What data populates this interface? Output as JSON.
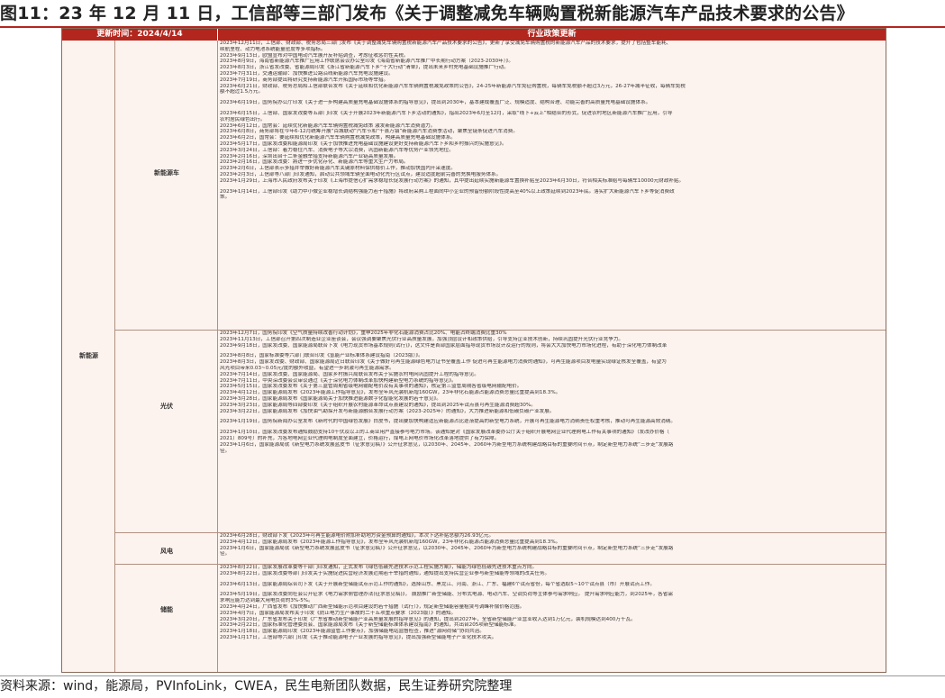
{
  "title": "图11：23 年 12 月 11 日，工信部等三部门发布《关于调整减免车辆购置税新能源汽车产品技术要求的公告》",
  "table": {
    "header_left": "更新时间：2024/4/14",
    "header_right": "行业政策更新",
    "category_main": "新能源",
    "sub_ev": "新能源车",
    "sub_pv": "光伏",
    "sub_wind": "风电",
    "sub_storage": "储能"
  },
  "ev_items": [
    "2023年12月11日，工信部、财政部、税务总局三部门发布《关于调整减免车辆购置税新能源汽车产品技术要求的公告》，更新了享受减免车辆购置税的新能源汽车产品的技术要求，提升了包括整车能耗、",
    "续航里程、动力电池系统能量密度等多项指标。",
    "2023年9月13日，欧盟宣布对中国电动汽车展开反补贴调查，考虑征收惩罚性关税。",
    "2023年8月9日，海南省新能源汽车推广应用工作联席会议办公室印发《海南省新能源汽车推广中长期行动方案（2023-2030年）》。",
    "2023年8月3日，浙江省发改委、省能源局印发《浙江省新能源汽车下乡“十大行动”清单》，提出未来乡村充电基础设施推广行动。",
    "2023年7月31日，交通运输部：加快推进公路沿线新能源汽车充电设施建设。",
    "2023年7月19日，商务部提出将研究支持新能源汽车开拓国际市场等举措。",
    "2023年6月21日，财政部、税务总局和工信部联合发布《关于延续和优化新能源汽车车辆购置税减免政策的公告》，24-25年新能源汽车免征购置税，每辆车免税额不超过3万元，26-27年减半征收，每辆车免税",
    "额不超过1.5万元。",
    "",
    "2023年6月19日，国务院办公厅印发《关于进一步构建高质量充电基础设施体系的指导意见》，提出到2030年，基本建成覆盖广泛、规模适度、结构合理、功能完善的高质量充电基础设施体系。",
    "",
    "2023年6月15日，工信部、国家发改委等五部门印发《关于开展2023年新能源汽车下乡活动的通知》，指出2023年6月至12月，采取“线下+云上”相结合的形式，促进农村地区新能源汽车推广应用，引导",
    "农村居民绿色出行。",
    "2023年6月12日，国常会：延续优化新能源汽车车辆购置税减免政策 激发新能源汽车消费潜力。",
    "2023年6月8日，商务部将在今年6-12月统筹开展“百城联动”汽车节和“千县万镇”新能源汽车消费季活动，聚焦全链条促进汽车消费。",
    "2023年6月2日，国常会：要延续和优化新能源汽车车辆购置税减免政策，构建高质量充电基础设施体系。",
    "2023年5月17日，国家发改委和能源局印发《关于加快推进充电基础设施建设更好支持新能源汽车下乡和乡村振兴的实施意见》。",
    "2023年3月24日，工信部：着力稳住汽车、消费电子等大宗消费，巩固新能源汽车等优势产业领先地位。",
    "2023年2月16日，深圳出台十二条金融举措支持新能源汽车产业链高质量发展。",
    "2023年2月16日，国家发改委：將进一步优化存化、新能源汽车等重大生产力布局。",
    "2023年2月6日，工信部表示多措并举做好新能源汽车关键原材料保供稳价工作，推动加快国内开采速度。",
    "2023年2月3日，工信部等八部门印发通知，启动公共领域车辆全面电动化先行区试点，建设适度超前完善的充换电服务体系。",
    "2023年1月29日，上海市人民政府发布关于印发《上海市提信心扩需求稳增长促发展行动方案》的通知，其中提出延续实施新能源车置换补贴至2023年6月30日，符合相关标准给与每辆车10000元财政补贴。",
    "",
    "2023年1月14日，工信部印发《助力中小微企业稳增长调结构强能力若干措施》将政府采购工程面向中小企业的预留份额阶段性提高至40%以上政策延续到2023年底。落实扩大新能源汽车下乡等促消费政",
    "策。"
  ],
  "pv_items": [
    "2023年12月7日，国务院印发《空气质量持续改善行动计划》，重申2025年非化石能源消费占比20%、电能占终端消费比重30%",
    "2023年11月13日，工信部召开第四次制造业企业座谈会，会议强调要聚焦光伏行业高质量发展，加强顶层设计和政策供给，引导支持企业技术创新，持续巩固提升光伏行业竞争力。",
    "2023年9月18日，国家发改委、国家能源局联合下发《电力现货市场基本规则(试行)》，这文件是首部国家层面指导现货市场设计及运行的规则，将会大大加快电力市场化进程，有助于深化电力体制改革",
    "",
    "2023年8月8日，国家标准委等六部门联合印发《氢能产业标准体系建设指南（2023版）》。",
    "2023年8月3日，国家发改委、财政部、国家能源局近日联合印发《关于做好可再生能源绿色电力证书全覆盖工作 促进可再生能源电力消费的通知》，可再生能源项目发电量实现绿证核发全覆盖，有望为",
    "风光项目带来0.03~0.05元/度的额外收益，有望进一步刺激可再生能源需求。",
    "2023年7月14日，国家发改委、国家能源局、国家乡村振兴局联合发布关于实施农村电网巩固提升工程的指导意见。",
    "2023年7月11日，中央深改委会议审议通过《关于深化电力体制改革加快构建新型电力系统的指导意见》。",
    "2023年5月15日，国家发改委发布《关于第三监管周期省级电网输配电价及有关事项的通知》，核定第三监管周期各省级电网输配电价。",
    "2023年4月12日，国家能源局发布《2023年能源工作指导意见》，发布全年风光装机新增160GW，23年非化石能源占能源消费总量比重提高到18.3%。",
    "2023年3月28日，国家能源局发布《国家能源局关于加快推进能源数字化智能化发展的若干意见》。",
    "2023年3月23日，国家能源局等四部委印发《关于组织开展农村能源革命试点县建设的通知》，提出到2025年试点县可再生能源消费超30%。",
    "2023年3月22日，国家能源局发布《加快油气勘探开发与新能源融合发展行动方案（2023-2025年）的通知》，大力推进新能源和低碳负碳产业发展。",
    "",
    "2023年1月19日，国务院新闻办公室发布《新时代的中国绿色发展》白皮书，提出要加快构建适应新能源占比逐渐提高的新型电力系统，开展可再生能源电力消纳责任权重考核，推动可再生能源高效消纳。",
    "",
    "2023年1月10日，国家发改委发布通知鼓励支持10千伏及以上的工商业用户直接参与电力市场。该通知是对《国家发展改革委办公厅关于组织开展电网企业代理购电工作有关事项的通知》（发改办价格〔",
    "2021〕809号）的补充，为各地电网企业代理购电制度全面建立，价格运行，煤电上网电价市场化改革落地提供了有力保障。",
    "2023年1月6日，国家能源局就《新型电力系统发展蓝皮书（征求意见稿）》公开征求意见，以2030年、2045年、2060年为新型电力系统构建战略目标的重要时间节点，制定新型电力系统“三步走”发展路",
    "径。"
  ],
  "wind_items": [
    "2023年6月28日，财政部下发《2023年可再生能源电价附加补助地方资金预算的通知》，本次下达补贴总额为26.93亿元。",
    "2023年4月12日，国家能源局发布《2023年能源工作指导意见》，发布全年风光装机新增160GW，23年非化石能源占能源消费总量比重提高到18.3%。",
    "2023年1月6日，国家能源局就《新型电力系统发展蓝皮书（征求意见稿）》公开征求意见，以2030年、2045年、2060年为新型电力系统构建战略目标的重要时间节点，制定新型电力系统“三步走”发展路",
    "径。"
  ],
  "storage_items": [
    "2023年8月22日，国家发展改革委等十部门印发通知，正式发布《绿色低碳先进技术示范工程实施方案》，储能为绿色低碳先进技术重点方向。",
    "2023年8月22日，国家发改委等部门印发关于实施促进民营经济发展近期若干举措的通知，通知提出支持民营企业参与新型储能等领域的改关任务。",
    "",
    "2023年6月13日，国家能源局综合司下发《关于开展新型储能试点示范工作的通知》，选择山东、黑龙江、河南、浙江、广东、福建6个试点省份，每个省选取5~10个试点县（市）开展试点工作。",
    "",
    "2023年5月19日，国家发改委向社会公开征求《电力需求侧管理办法(征求意见稿)》， 鼓励推广新型储能、分布式电源、电动汽车、空调负荷等主体参与需求响应。 提升需求响应能力，到2025年，各省需",
    "求响应能力达到最大用电负荷的3%-5%。",
    "2023年4月24日，广西省发布《加快推动广西新型储能示范项目建设的若干措施（试行）》，规定新型储能容量租赁与调峰补偿价格范围。",
    "2023年4月7日，国家能源局发布关于印发《防止电力生产事故的二十五项重点要求（2023版）》的通知。",
    "2023年3月20日，广东省发布关于印发《广东省推动新型储能产业高质量发展的指导意见》的通知，提出到2027年，全省新型储能产业营业收入达到1万亿元，装机规模达到400万千瓦。",
    "2023年2月22日，国家标准化管理委员会、国家能源局发布《关于新型储能标准体系建设指南》的通知，共出台205项新型储能标准。",
    "2023年1月18日，国家能源局印发《2023年能源监管工作要点》，加强储能电站监督检查，推进“源网荷储”协同共治。",
    "2023年1月17日，工信部等六部门印发《关于推动能源电子产业发展的指导意见》，提出加强新型储能电子产业化技术攻关。"
  ],
  "source": "资料来源：wind，能源局，PVInfoLink，CWEA，民生电新团队数据，民生证券研究院整理"
}
